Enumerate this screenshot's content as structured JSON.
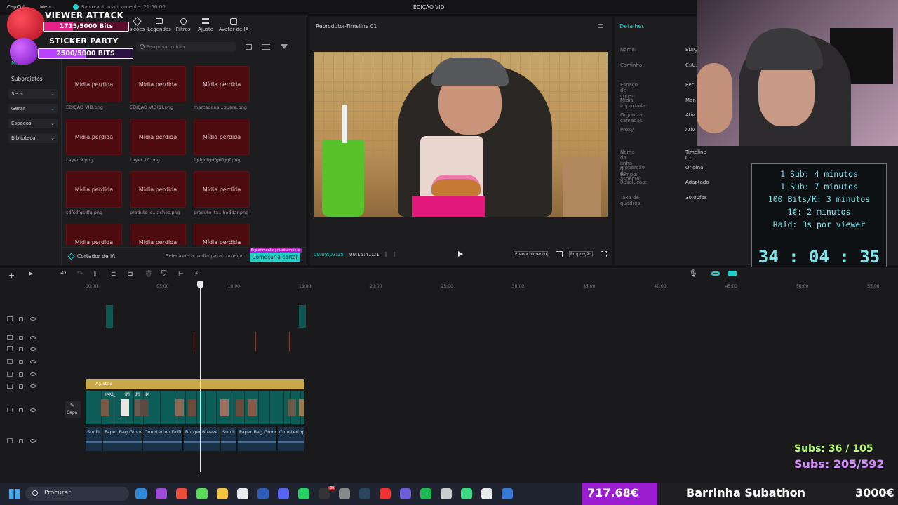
{
  "topbar": {
    "menu_label": "Menu",
    "autosave": "Salvo automaticamente: 21:56:00",
    "project_title": "EDIÇÃO VID",
    "app_name": "CapCut"
  },
  "alerts": [
    {
      "title": "VIEWER ATTACK",
      "progress_text": "1715/5000 Bits",
      "progress": 0.343
    },
    {
      "title": "STICKER PARTY",
      "progress_text": "2500/5000 BITS",
      "progress": 0.5
    }
  ],
  "toolbar": {
    "items": [
      "Transições",
      "Legendas",
      "Filtros",
      "Ajuste",
      "Avatar de IA"
    ]
  },
  "media": {
    "search_placeholder": "Pesquisar mídia",
    "sidebar": {
      "first": "Mídia",
      "items": [
        "Subprojetos",
        "Seus",
        "Gerar",
        "Espaços",
        "Biblioteca"
      ]
    },
    "card_text": "Mídia perdida",
    "files": [
      "EDIÇÃO VID.png",
      "EDIÇÃO VID(1).png",
      "marcadona...quare.png",
      "Layer 9.png",
      "Layer 10.png",
      "fgdgdfgdfgdfggf.png",
      "sdfsdfgsdfg.png",
      "produto_c...achos.png",
      "produto_ta...heddar.png",
      "",
      "",
      ""
    ],
    "ai_cutter": "Cortador de IA",
    "select_hint": "Selecione a mídia para começar",
    "start_cut": "Começar a cortar",
    "experiment_badge": "Experimente gratuitamente"
  },
  "player": {
    "title": "Reprodutor-Timeline 01",
    "time_current": "00:08:07:15",
    "time_total": "00:15:41:21",
    "fill_label": "Preenchimento",
    "ratio_label": "Proporção"
  },
  "details": {
    "title": "Detalhes",
    "rows": [
      {
        "label": "Nome:",
        "value": "EDIÇ"
      },
      {
        "label": "Caminho:",
        "value": "C:/U..."
      },
      {
        "label": "Espaço de cores:",
        "value": "Rec..."
      },
      {
        "label": "Mídia importada:",
        "value": "Man"
      },
      {
        "label": "Organizar camadas",
        "value": "Ativ"
      },
      {
        "label": "Proxy:",
        "value": "Ativ"
      },
      {
        "label": "Nome da linha do tempo:",
        "value": "Timeline 01"
      },
      {
        "label": "Proporção de aspecto:",
        "value": "Original"
      },
      {
        "label": "Resolução:",
        "value": "Adaptado"
      },
      {
        "label": "Taxa de quadros:",
        "value": "30.00fps"
      }
    ]
  },
  "subathon": {
    "rules": [
      "1 Sub: 4 minutos",
      "1 Sub: 7 minutos",
      "100 Bits/K: 3 minutos",
      "1€: 2 minutos",
      "Raid: 3s por viewer"
    ],
    "timer": "34 : 04 : 35",
    "subs_line1": "Subs: 36 / 105",
    "subs_line2": "Subs: 205/592",
    "money": "717.68€",
    "bar_label": "Barrinha Subathon",
    "goal": "3000€",
    "progress": 0.239
  },
  "timeline": {
    "ruler": [
      "00:00",
      "05:00",
      "10:00",
      "15:00",
      "20:00",
      "25:00",
      "30:00",
      "35:00",
      "40:00",
      "45:00",
      "50:00",
      "55:00"
    ],
    "adjust_label": "Ajuste3",
    "cover_label": "Capa",
    "clip_badges": [
      "IMG_",
      "IM",
      "IM",
      "IM"
    ],
    "audio_clips": [
      "Sunlit",
      "Paper Bag Groove",
      "Countertop Drift.r",
      "Burger Breeze.m",
      "Sunlit",
      "Paper Bag Groove",
      "Countertop"
    ]
  },
  "taskbar": {
    "search": "Procurar",
    "badge": "36"
  },
  "colors": {
    "accent": "#1fd1c8",
    "media_missing": "#4d0b10",
    "clip": "#0e6b66",
    "adjust": "#c9a84a",
    "timer": "#7de8f0",
    "subs": "#b6ff6a",
    "money_bg": "#9b1fd1"
  }
}
